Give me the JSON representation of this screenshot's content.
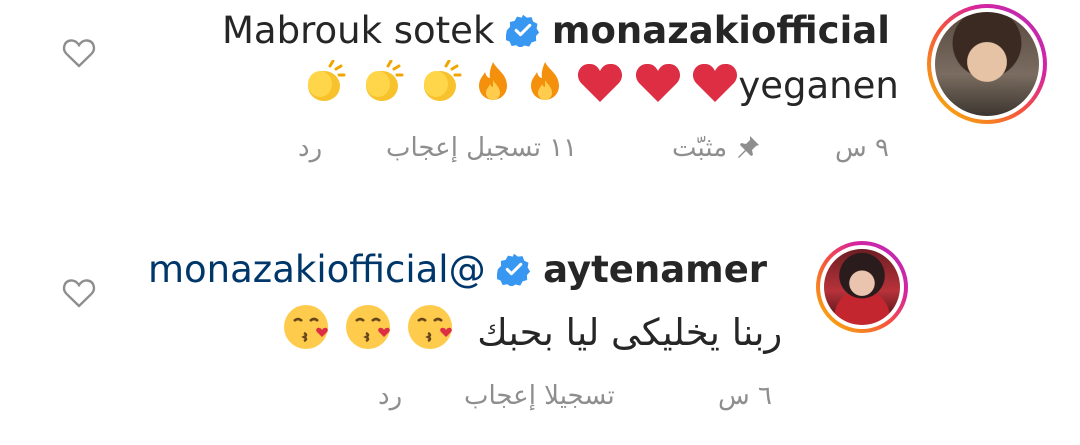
{
  "comments": [
    {
      "username": "monazakiofficial",
      "text_line1": "Mabrouk sotek",
      "text_line2": "yeganen",
      "time": "٩ س",
      "pinned_label": "مثبّت",
      "likes_label": "١١ تسجيل إعجاب",
      "reply_label": "رد",
      "verified": true
    },
    {
      "username": "aytenamer",
      "mention": "monazakiofficial@",
      "text_line2": "ربنا يخليكى ليا بحبك",
      "time": "٦ س",
      "likes_label": "تسجيلا إعجاب",
      "reply_label": "رد",
      "verified": true
    }
  ],
  "colors": {
    "verified_blue": "#3897f0",
    "meta_gray": "#8e8e8e",
    "mention_blue": "#00376b"
  }
}
